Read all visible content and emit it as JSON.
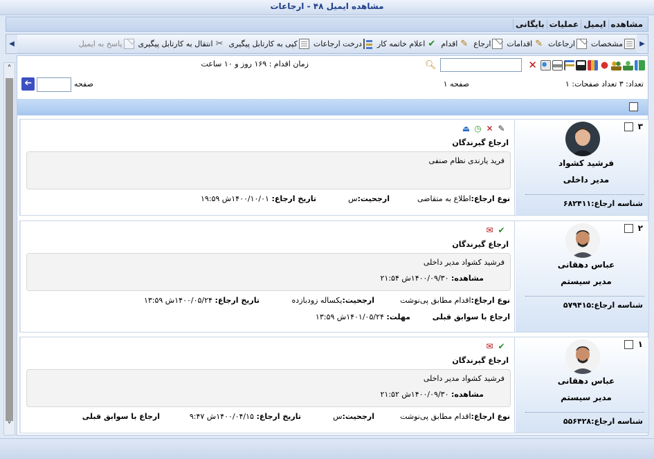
{
  "window": {
    "title": "مشاهده ایمیل  ۴۸  - ارجاعات"
  },
  "menu": [
    "مشاهده",
    "ایمیل",
    "عملیات",
    "بایگانی"
  ],
  "toolbar": [
    {
      "label": "مشخصات",
      "icon": "document-icon"
    },
    {
      "label": "ارجاعات",
      "icon": "referral-mail-icon"
    },
    {
      "label": "اقدامات",
      "icon": "actions-pencil-icon"
    },
    {
      "label": "ارجاع",
      "icon": "mail-icon"
    },
    {
      "label": "اقدام",
      "icon": "pencil-icon"
    },
    {
      "label": "اعلام خاتمه کار",
      "icon": "check-icon"
    },
    {
      "label": "درخت ارجاعات",
      "icon": "tree-icon"
    },
    {
      "label": "کپی به کارتابل پیگیری",
      "icon": "copy-icon"
    },
    {
      "label": "انتقال به کارتابل پیگیری",
      "icon": "scissors-icon"
    },
    {
      "label": "پاسخ به ایمیل",
      "icon": "reply-icon",
      "disabled": true
    }
  ],
  "top": {
    "time_label": "زمان اقدام :  ۱۶۹ روز  و  ۱۰ ساعت",
    "count_label": "تعداد: ۳   تعداد صفحات: ۱",
    "page_current": "صفحه ۱",
    "page_label": "صفحه",
    "go_arrow": "➔"
  },
  "cards": [
    {
      "num": "۳",
      "person_name": "فرشید کشواد",
      "person_role": "مدیر داخلی",
      "ref_id": "شناسه ارجاع:۶۸۲۴۱۱",
      "recv_title": "ارجاع گیرندگان",
      "recv_text": "فرید یارندی نظام صنفی",
      "ref_type_label": "نوع ارجاع:",
      "ref_type": "اطلاع به متقاضی",
      "priority_label": "ارجحیت:",
      "priority": "س",
      "date_label": "تاریخ ارجاع:",
      "date": "۱۴۰۰/۱۰/۰۱ش ۱۹:۵۹"
    },
    {
      "num": "۲",
      "person_name": "عباس دهقانی",
      "person_role": "مدیر سیستم",
      "ref_id": "شناسه ارجاع:۵۷۹۴۱۵",
      "recv_title": "ارجاع گیرندگان",
      "recv_text": "فرشید کشواد مدیر داخلی",
      "seen_label": "مشاهده:",
      "seen": "۱۴۰۰/۰۹/۳۰ش ۲۱:۵۴",
      "ref_type_label": "نوع ارجاع:",
      "ref_type": "اقدام مطابق پی‌نوشت",
      "priority_label": "ارجحیت:",
      "priority": "یکساله زودبازده",
      "date_label": "تاریخ ارجاع:",
      "date": "۱۴۰۰/۰۵/۲۴ش ۱۳:۵۹",
      "history": "ارجاع با سوابق قبلی",
      "deadline_label": "مهلت:",
      "deadline": "۱۴۰۱/۰۵/۲۴ش ۱۳:۵۹"
    },
    {
      "num": "۱",
      "person_name": "عباس دهقانی",
      "person_role": "مدیر سیستم",
      "ref_id": "شناسه ارجاع:۵۵۶۴۲۸",
      "recv_title": "ارجاع گیرندگان",
      "recv_text": "فرشید کشواد مدیر داخلی",
      "seen_label": "مشاهده:",
      "seen": "۱۴۰۰/۰۹/۳۰ش ۲۱:۵۲",
      "ref_type_label": "نوع ارجاع:",
      "ref_type": "اقدام مطابق پی‌نوشت",
      "priority_label": "ارجحیت:",
      "priority": "س",
      "date_label": "تاریخ ارجاع:",
      "date": "۱۴۰۰/۰۴/۱۵ش ۹:۴۷",
      "history": "ارجاع با سوابق قبلی"
    }
  ],
  "colors": {
    "accent": "#3c4fc2",
    "header": "#a6c6ee",
    "title": "#1f3f8a"
  }
}
